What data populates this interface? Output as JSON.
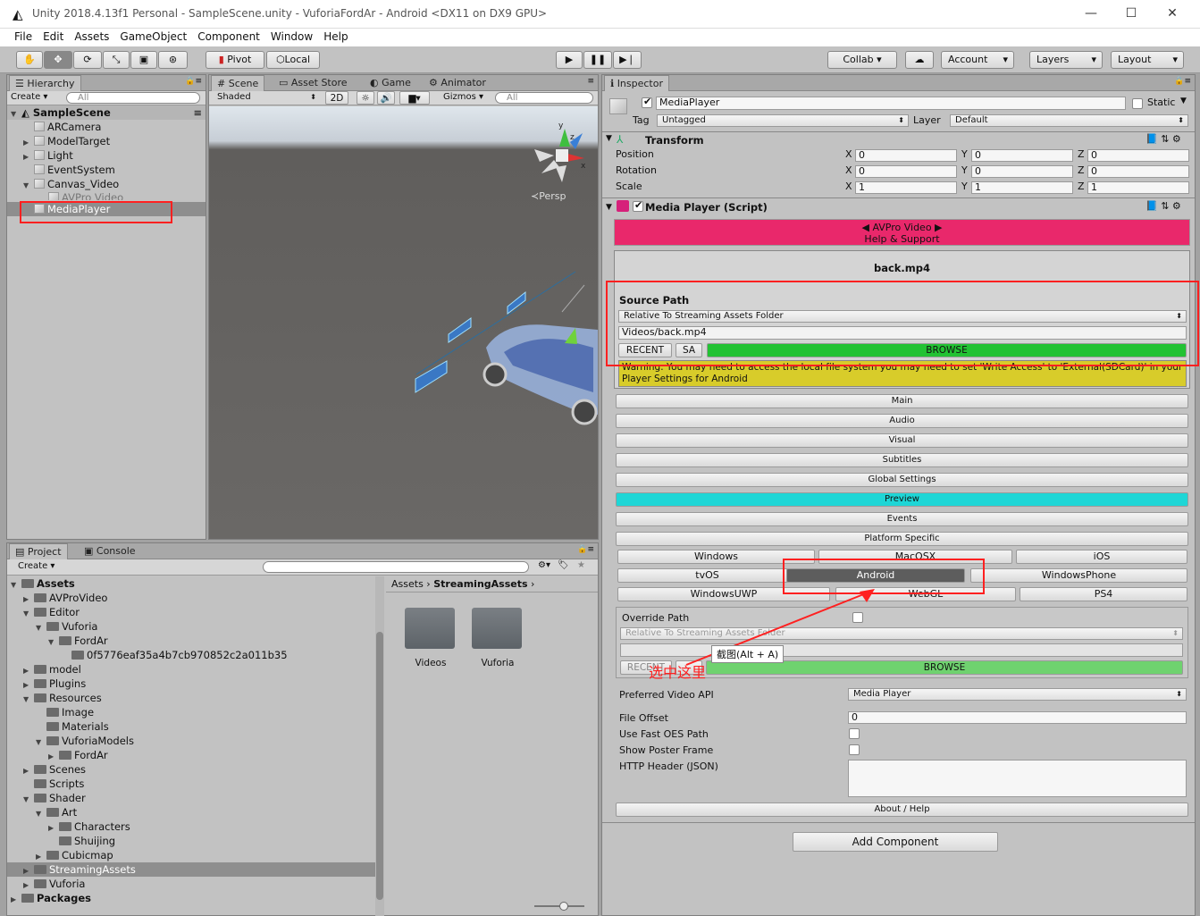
{
  "window": {
    "title": "Unity 2018.4.13f1 Personal - SampleScene.unity - VuforiaFordAr - Android <DX11 on DX9 GPU>",
    "minimize": "—",
    "maximize": "☐",
    "close": "✕"
  },
  "menu": [
    "File",
    "Edit",
    "Assets",
    "GameObject",
    "Component",
    "Window",
    "Help"
  ],
  "toolbar": {
    "pivot": "Pivot",
    "local": "Local",
    "collab": "Collab ▾",
    "account": "Account",
    "layers": "Layers",
    "layout": "Layout"
  },
  "hierarchy": {
    "tab": "Hierarchy",
    "create": "Create ▾",
    "search": "All",
    "scene": "SampleScene",
    "items": [
      "ARCamera",
      "ModelTarget",
      "Light",
      "EventSystem",
      "Canvas_Video",
      "AVPro Video",
      "MediaPlayer"
    ]
  },
  "scene": {
    "tabs": [
      "Scene",
      "Asset Store",
      "Game",
      "Animator"
    ],
    "shaded": "Shaded",
    "mode2d": "2D",
    "gizmos": "Gizmos ▾",
    "search": "All",
    "persp": "≺Persp",
    "axis_y": "y",
    "axis_z": "z",
    "axis_x": "x"
  },
  "project": {
    "tabs": [
      "Project",
      "Console"
    ],
    "create": "Create ▾",
    "tree": [
      "Assets",
      "AVProVideo",
      "Editor",
      "Vuforia",
      "FordAr",
      "0f5776eaf35a4b7cb970852c2a011b35",
      "model",
      "Plugins",
      "Resources",
      "Image",
      "Materials",
      "VuforiaModels",
      "FordAr",
      "Scenes",
      "Scripts",
      "Shader",
      "Art",
      "Characters",
      "Shuijing",
      "Cubicmap",
      "StreamingAssets",
      "Vuforia",
      "Packages"
    ],
    "breadcrumb": [
      "Assets",
      "StreamingAssets"
    ],
    "folders": [
      "Videos",
      "Vuforia"
    ]
  },
  "inspector": {
    "tab": "Inspector",
    "object_name": "MediaPlayer",
    "static": "Static",
    "tag_label": "Tag",
    "tag": "Untagged",
    "layer_label": "Layer",
    "layer": "Default",
    "transform": {
      "title": "Transform",
      "rows": [
        {
          "label": "Position",
          "x": "0",
          "y": "0",
          "z": "0"
        },
        {
          "label": "Rotation",
          "x": "0",
          "y": "0",
          "z": "0"
        },
        {
          "label": "Scale",
          "x": "1",
          "y": "1",
          "z": "1"
        }
      ]
    },
    "script_title": "Media Player (Script)",
    "banner1": "◀ AVPro Video ▶",
    "banner2": "Help & Support",
    "file": "back.mp4",
    "source_path": "Source Path",
    "location": "Relative To Streaming Assets Folder",
    "path": "Videos/back.mp4",
    "recent": "RECENT",
    "sa": "SA",
    "browse": "BROWSE",
    "warning": "Warning: You may need to access the local file system you may need to set 'Write Access' to 'External(SDCard)' in your Player Settings for Android",
    "sections": [
      "Main",
      "Audio",
      "Visual",
      "Subtitles",
      "Global Settings",
      "Preview",
      "Events",
      "Platform Specific"
    ],
    "platforms_row1": [
      "Windows",
      "MacOSX",
      "iOS"
    ],
    "platforms_row2": [
      "tvOS",
      "Android",
      "WindowsPhone"
    ],
    "platforms_row3": [
      "WindowsUWP",
      "WebGL",
      "PS4"
    ],
    "override_path": "Override Path",
    "override_location": "Relative To Streaming Assets Folder",
    "tooltip": "截图(Alt + A)",
    "annotation": "选中这里",
    "preferred_api_label": "Preferred Video API",
    "preferred_api": "Media Player",
    "file_offset_label": "File Offset",
    "file_offset": "0",
    "fast_oes": "Use Fast OES Path",
    "poster": "Show Poster Frame",
    "http_header": "HTTP Header (JSON)",
    "about": "About / Help",
    "add_component": "Add Component"
  },
  "colors": {
    "banner": "#e9286b",
    "browse": "#22c233",
    "warning": "#d8cc2a",
    "preview": "#1ed6d6",
    "highlight": "#ff2020"
  }
}
